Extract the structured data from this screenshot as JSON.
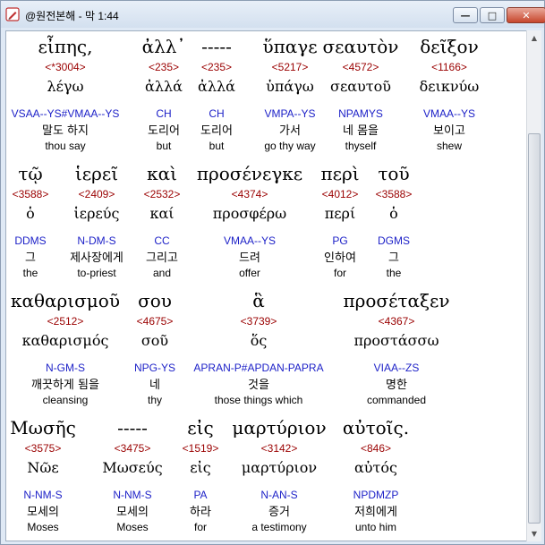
{
  "window": {
    "title": "@원전본해 - 막 1:44",
    "app_icon": "pencil-edit-icon",
    "minimize_glyph": "—",
    "maximize_glyph": "□",
    "close_glyph": "✕"
  },
  "colors": {
    "strong": "#9a0000",
    "morph": "#1e22c8",
    "text": "#000000"
  },
  "rows": [
    {
      "words": [
        {
          "greek": "εἶπης,",
          "strong": "<*3004>",
          "lemma": "λέγω",
          "morph": "VSAA--YS#VMAA--YS",
          "korean": "말도 하지",
          "english": "thou say"
        },
        {
          "greek": "ἀλλ᾽",
          "strong": "<235>",
          "lemma": "ἀλλά",
          "morph": "CH",
          "korean": "도리어",
          "english": "but"
        },
        {
          "greek": "-----",
          "strong": "<235>",
          "lemma": "ἀλλά",
          "morph": "CH",
          "korean": "도리어",
          "english": "but"
        },
        {
          "greek": "ὕπαγε",
          "strong": "<5217>",
          "lemma": "ὑπάγω",
          "morph": "VMPA--YS",
          "korean": "가서",
          "english": "go thy way"
        },
        {
          "greek": "σεαυτὸν",
          "strong": "<4572>",
          "lemma": "σεαυτοῦ",
          "morph": "NPAMYS",
          "korean": "네 몸을",
          "english": "thyself"
        },
        {
          "greek": "δεῖξον",
          "strong": "<1166>",
          "lemma": "δεικνύω",
          "morph": "VMAA--YS",
          "korean": "보이고",
          "english": "shew"
        }
      ]
    },
    {
      "words": [
        {
          "greek": "τῷ",
          "strong": "<3588>",
          "lemma": "ὁ",
          "morph": "DDMS",
          "korean": "그",
          "english": "the"
        },
        {
          "greek": "ἱερεῖ",
          "strong": "<2409>",
          "lemma": "ἱερεύς",
          "morph": "N-DM-S",
          "korean": "제사장에게",
          "english": "to-priest"
        },
        {
          "greek": "καὶ",
          "strong": "<2532>",
          "lemma": "καί",
          "morph": "CC",
          "korean": "그리고",
          "english": "and"
        },
        {
          "greek": "προσένεγκε",
          "strong": "<4374>",
          "lemma": "προσφέρω",
          "morph": "VMAA--YS",
          "korean": "드려",
          "english": "offer"
        },
        {
          "greek": "περὶ",
          "strong": "<4012>",
          "lemma": "περί",
          "morph": "PG",
          "korean": "인하여",
          "english": "for"
        },
        {
          "greek": "τοῦ",
          "strong": "<3588>",
          "lemma": "ὁ",
          "morph": "DGMS",
          "korean": "그",
          "english": "the"
        }
      ]
    },
    {
      "words": [
        {
          "greek": "καθαρισμοῦ",
          "strong": "<2512>",
          "lemma": "καθαρισμός",
          "morph": "N-GM-S",
          "korean": "깨끗하게 됨을",
          "english": "cleansing"
        },
        {
          "greek": "σου",
          "strong": "<4675>",
          "lemma": "σοῦ",
          "morph": "NPG-YS",
          "korean": "네",
          "english": "thy"
        },
        {
          "greek": "ἃ",
          "strong": "<3739>",
          "lemma": "ὅς",
          "morph": "APRAN-P#APDAN-PAPRA",
          "korean": "것을",
          "english": "those things which"
        },
        {
          "greek": "προσέταξεν",
          "strong": "<4367>",
          "lemma": "προστάσσω",
          "morph": "VIAA--ZS",
          "korean": "명한",
          "english": "commanded"
        }
      ]
    },
    {
      "words": [
        {
          "greek": "Μωσῆς",
          "strong": "<3575>",
          "lemma": "Νῶε",
          "morph": "N-NM-S",
          "korean": "모세의",
          "english": "Moses"
        },
        {
          "greek": "-----",
          "strong": "<3475>",
          "lemma": "Μωσεύς",
          "morph": "N-NM-S",
          "korean": "모세의",
          "english": "Moses"
        },
        {
          "greek": "εἰς",
          "strong": "<1519>",
          "lemma": "εἰς",
          "morph": "PA",
          "korean": "하라",
          "english": "for"
        },
        {
          "greek": "μαρτύριον",
          "strong": "<3142>",
          "lemma": "μαρτύριον",
          "morph": "N-AN-S",
          "korean": "증거",
          "english": "a testimony"
        },
        {
          "greek": "αὐτοῖς.",
          "strong": "<846>",
          "lemma": "αὐτός",
          "morph": "NPDMZP",
          "korean": "저희에게",
          "english": "unto him"
        }
      ]
    }
  ]
}
